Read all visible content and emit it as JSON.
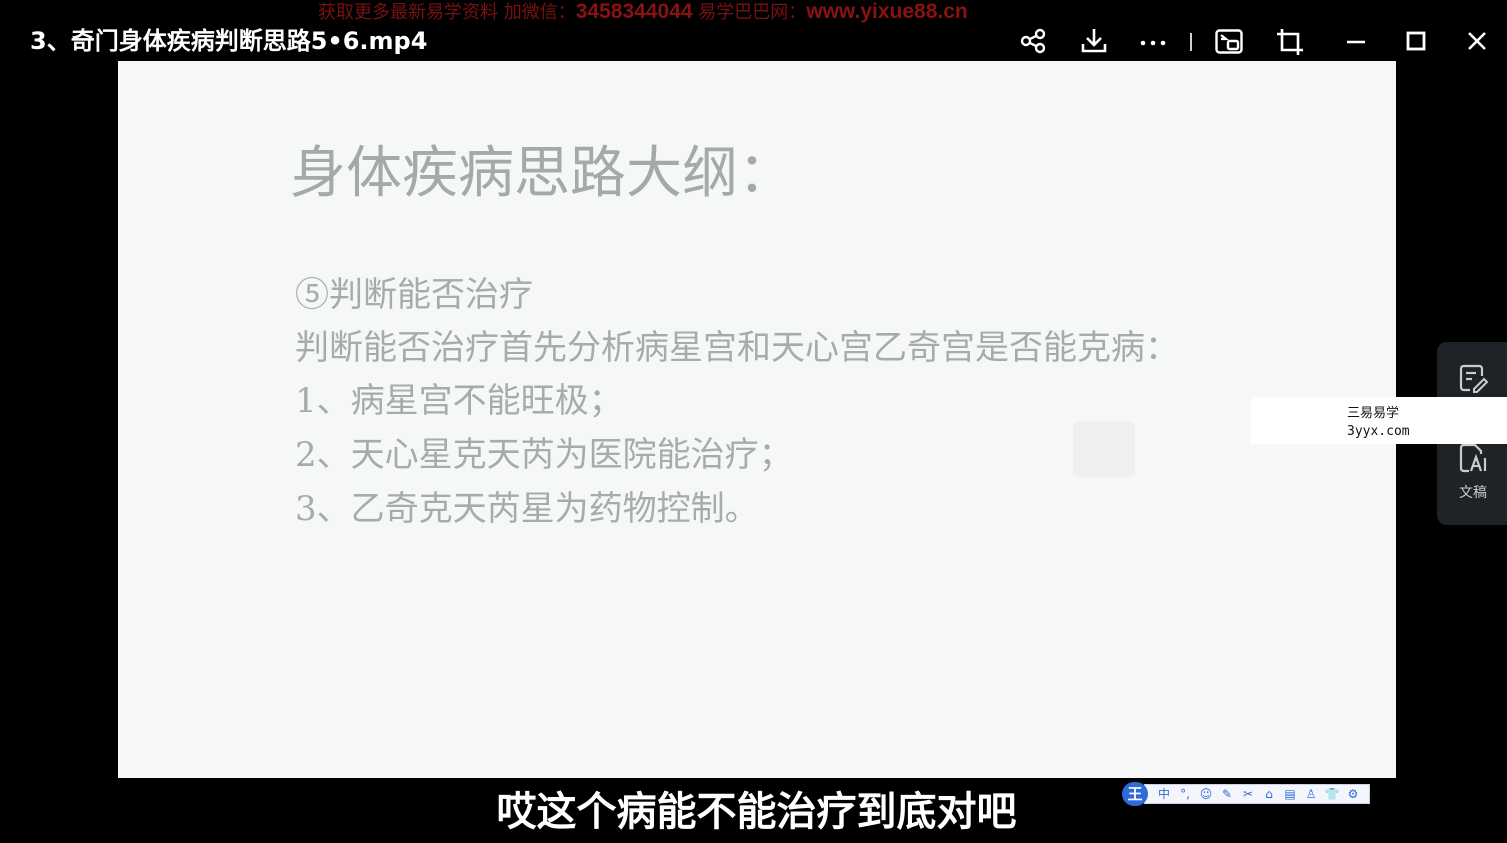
{
  "window": {
    "title": "3、奇门身体疾病判断思路5•6.mp4",
    "watermark_prefix": "获取更多最新易学资料 加微信：",
    "watermark_wechat": "3458344044",
    "watermark_mid": " 易学巴巴网：",
    "watermark_url": "www.yixue88.cn"
  },
  "toolbar": {
    "icons": [
      "share-icon",
      "download-icon",
      "more-icon",
      "picture-in-picture-icon",
      "crop-icon",
      "minimize-icon",
      "maximize-icon",
      "close-icon"
    ],
    "colors": {
      "icon": "#ffffff",
      "background": "#000000"
    }
  },
  "slide": {
    "heading": "身体疾病思路大纲：",
    "lines": [
      "⑤判断能否治疗",
      "判断能否治疗首先分析病星宫和天心宫乙奇宫是否能克病：",
      "1、病星宫不能旺极；",
      "2、天心星克天芮为医院能治疗；",
      "3、乙奇克天芮星为药物控制。"
    ]
  },
  "side_panel": {
    "items": [
      "notes-edit-icon",
      "ai-transcript-icon"
    ],
    "transcript_label": "文稿"
  },
  "site_badge": {
    "name": "三易易学",
    "url": "3yyx.com"
  },
  "subtitle": "哎这个病能不能治疗到底对吧",
  "ime_toolbar": {
    "logo": "王",
    "items": [
      "中",
      "°,",
      "☺",
      "✎",
      "✂",
      "⌂",
      "▤",
      "♙",
      "👕",
      "⚙"
    ]
  }
}
